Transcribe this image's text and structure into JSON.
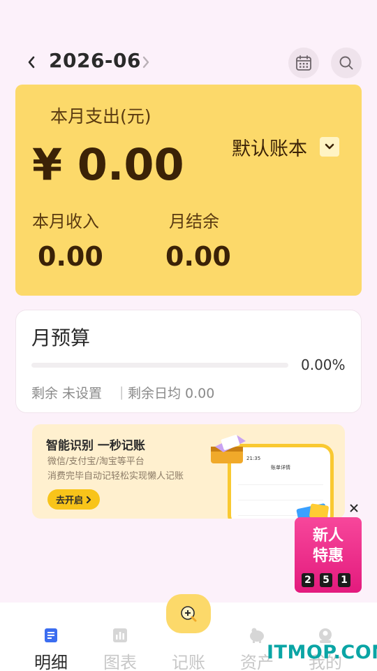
{
  "header": {
    "month": "2026-06"
  },
  "summary": {
    "expense_label": "本月支出(元)",
    "expense_amount": "¥ 0.00",
    "book_name": "默认账本",
    "income_label": "本月收入",
    "income_value": "0.00",
    "balance_label": "月结余",
    "balance_value": "0.00"
  },
  "budget": {
    "title": "月预算",
    "progress": 0,
    "percent": "0.00%",
    "remain": "剩余 未设置",
    "separator": "|",
    "daily_avg": "剩余日均 0.00"
  },
  "promo": {
    "title": "智能识别 一秒记账",
    "sub1": "微信/支付宝/淘宝等平台",
    "sub2": "消费完毕自动记轻松实现懒人记账",
    "button": "去开启",
    "phone_time": "21:35",
    "phone_title": "账单详情"
  },
  "coupon": {
    "line1": "新人",
    "line2": "特惠",
    "digits": [
      "2",
      "5",
      "1"
    ]
  },
  "tabs": [
    {
      "label": "明细",
      "icon": "list-icon",
      "active": true
    },
    {
      "label": "图表",
      "icon": "chart-icon",
      "active": false
    },
    {
      "label": "记账",
      "icon": "",
      "active": false
    },
    {
      "label": "资产",
      "icon": "piggy-bank-icon",
      "active": false
    },
    {
      "label": "我的",
      "icon": "user-icon",
      "active": false
    }
  ],
  "watermark": "ITMOP.COM",
  "colors": {
    "accent": "#fcd96a",
    "background": "#fcf1fa",
    "coupon": "#e31a7d"
  }
}
